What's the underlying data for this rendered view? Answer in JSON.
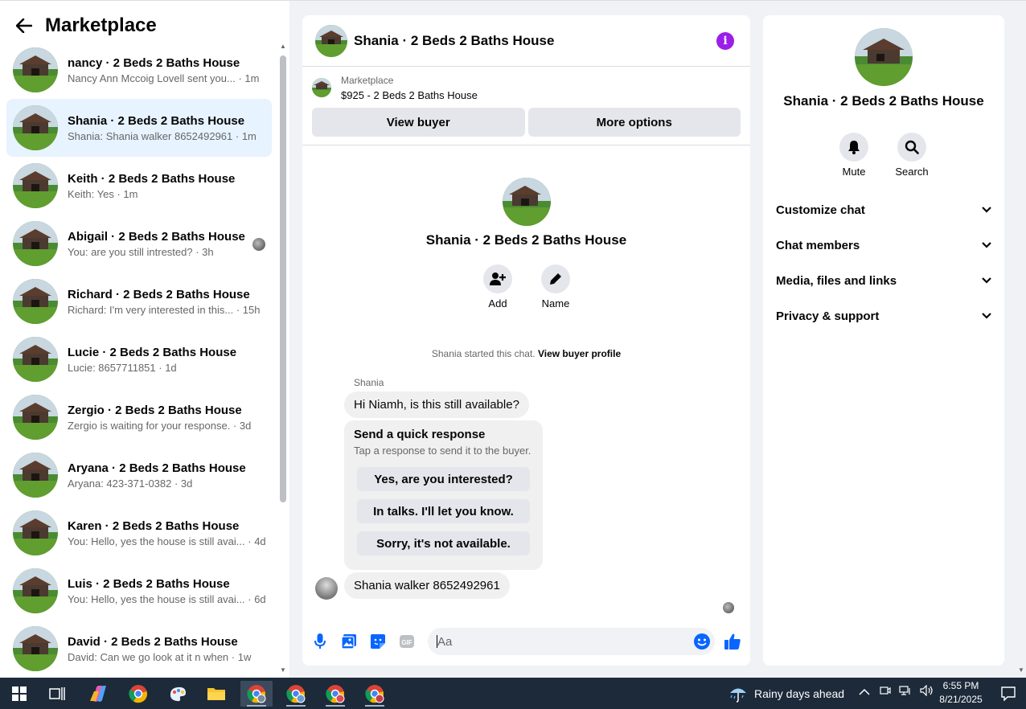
{
  "left": {
    "title": "Marketplace",
    "conversations": [
      {
        "name": "nancy · 2 Beds 2 Baths House",
        "preview": "Nancy Ann Mccoig Lovell sent you... · 1m"
      },
      {
        "name": "Shania · 2 Beds 2 Baths House",
        "preview": "Shania: Shania walker 8652492961 · 1m"
      },
      {
        "name": "Keith · 2 Beds 2 Baths House",
        "preview": "Keith: Yes · 1m"
      },
      {
        "name": "Abigail · 2 Beds 2 Baths House",
        "preview": "You: are you still intrested? · 3h"
      },
      {
        "name": "Richard · 2 Beds 2 Baths House",
        "preview": "Richard: I'm very interested in this... · 15h"
      },
      {
        "name": "Lucie · 2 Beds 2 Baths House",
        "preview": "Lucie: 8657711851 · 1d"
      },
      {
        "name": "Zergio · 2 Beds 2 Baths House",
        "preview": "Zergio is waiting for your response. · 3d"
      },
      {
        "name": "Aryana · 2 Beds 2 Baths House",
        "preview": "Aryana: 423-371-0382 · 3d"
      },
      {
        "name": "Karen · 2 Beds 2 Baths House",
        "preview": "You: Hello, yes the house is still avai... · 4d"
      },
      {
        "name": "Luis · 2 Beds 2 Baths House",
        "preview": "You: Hello, yes the house is still avai... · 6d"
      },
      {
        "name": "David · 2 Beds 2 Baths House",
        "preview": "David: Can we go look at it n when · 1w"
      }
    ]
  },
  "chat": {
    "title": "Shania · 2 Beds 2 Baths House",
    "info_icon": "i",
    "listing_source": "Marketplace",
    "listing_price": "$925 - 2 Beds 2 Baths House",
    "view_buyer": "View buyer",
    "more_options": "More options",
    "add_label": "Add",
    "name_label": "Name",
    "started_text": "Shania started this chat.",
    "view_buyer_profile": "View buyer profile",
    "sender": "Shania",
    "msg1": "Hi Niamh, is this still available?",
    "quick_title": "Send a quick response",
    "quick_sub": "Tap a response to send it to the buyer.",
    "quick_options": [
      "Yes, are you interested?",
      "In talks. I'll let you know.",
      "Sorry, it's not available."
    ],
    "msg2": "Shania walker 8652492961",
    "placeholder": "Aa",
    "accent": "#0866ff"
  },
  "right": {
    "name": "Shania · 2 Beds 2 Baths House",
    "mute": "Mute",
    "search": "Search",
    "sections": [
      "Customize chat",
      "Chat members",
      "Media, files and links",
      "Privacy & support"
    ]
  },
  "taskbar": {
    "weather": "Rainy days ahead",
    "time": "6:55 PM",
    "date": "8/21/2025"
  }
}
